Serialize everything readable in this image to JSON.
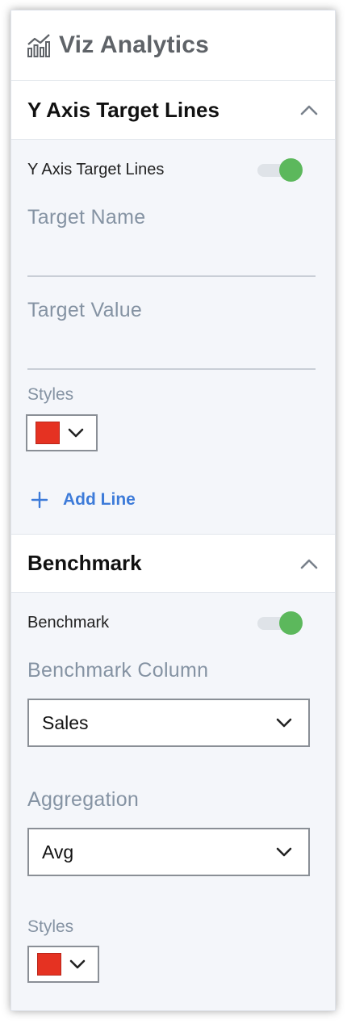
{
  "app": {
    "title": "Viz Analytics",
    "icon": "chart-bars-icon"
  },
  "target_lines": {
    "section_title": "Y Axis Target Lines",
    "toggle_label": "Y Axis Target Lines",
    "toggle_on": true,
    "target_name_label": "Target Name",
    "target_name_value": "",
    "target_value_label": "Target Value",
    "target_value_value": "",
    "styles_label": "Styles",
    "style_color": "#e53222",
    "add_line_label": "Add Line"
  },
  "benchmark": {
    "section_title": "Benchmark",
    "toggle_label": "Benchmark",
    "toggle_on": true,
    "column_label": "Benchmark Column",
    "column_value": "Sales",
    "aggregation_label": "Aggregation",
    "aggregation_value": "Avg",
    "styles_label": "Styles",
    "style_color": "#e53222"
  },
  "colors": {
    "accent_blue": "#3d7bd9",
    "toggle_green": "#5cb85c",
    "muted_label": "#8593a3"
  }
}
